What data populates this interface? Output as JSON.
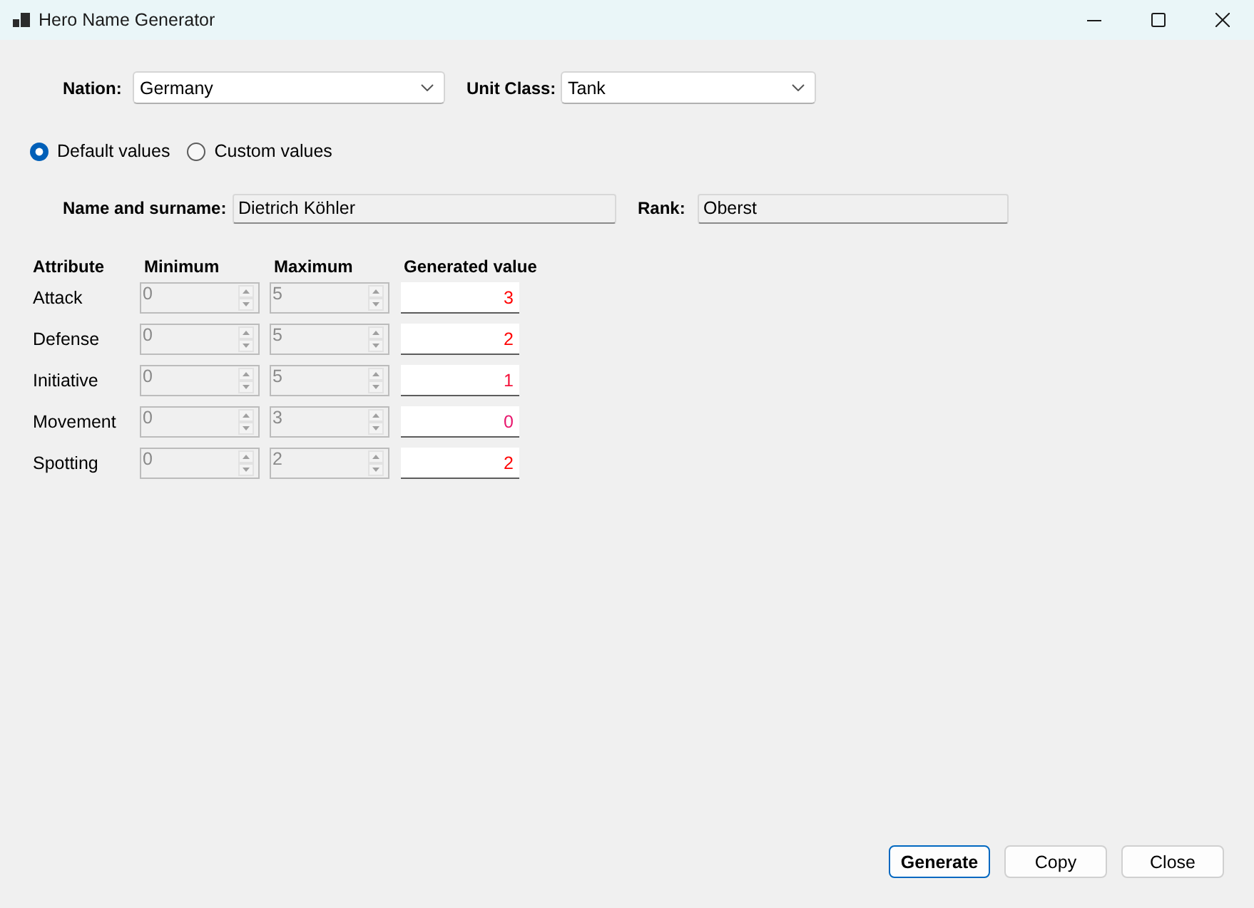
{
  "window": {
    "title": "Hero Name Generator"
  },
  "selectors": [
    {
      "label": "Nation:",
      "value": "Germany"
    },
    {
      "label": "Unit Class:",
      "value": "Tank"
    }
  ],
  "value_mode": [
    {
      "label": "Default values",
      "selected": true
    },
    {
      "label": "Custom values",
      "selected": false
    }
  ],
  "identity": [
    {
      "label": "Name and surname:",
      "value": "Dietrich Köhler"
    },
    {
      "label": "Rank:",
      "value": "Oberst"
    }
  ],
  "attributes": {
    "columns": [
      "Attribute",
      "Minimum",
      "Maximum",
      "Generated value"
    ],
    "rows": [
      {
        "name": "Attack",
        "minimum": "0",
        "maximum": "5",
        "disabled": true,
        "generated": "3",
        "color": "#ff0000"
      },
      {
        "name": "Defense",
        "minimum": "0",
        "maximum": "5",
        "disabled": true,
        "generated": "2",
        "color": "#ff0000"
      },
      {
        "name": "Initiative",
        "minimum": "0",
        "maximum": "5",
        "disabled": true,
        "generated": "1",
        "color": "#f4143c"
      },
      {
        "name": "Movement",
        "minimum": "0",
        "maximum": "3",
        "disabled": true,
        "generated": "0",
        "color": "#e8186e"
      },
      {
        "name": "Spotting",
        "minimum": "0",
        "maximum": "2",
        "disabled": true,
        "generated": "2",
        "color": "#ff0000"
      }
    ]
  },
  "buttons": [
    {
      "label": "Generate",
      "default": true
    },
    {
      "label": "Copy",
      "default": false
    },
    {
      "label": "Close",
      "default": false
    }
  ]
}
